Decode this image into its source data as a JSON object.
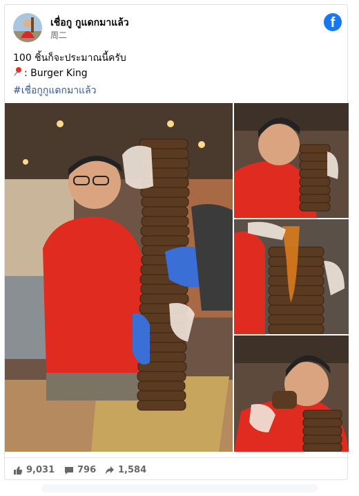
{
  "post": {
    "author": "เชื่อกู กูแดกมาแล้ว",
    "time": "周二",
    "brand_icon": "facebook-icon",
    "text_line1": "100 ชิ้นก็จะประมาณนี้ครับ",
    "text_line2": ": Burger King",
    "pin_icon": "round-pushpin-icon",
    "hashtag": "#เชื่อกูกูแดกมาแล้ว"
  },
  "stats": {
    "likes": "9,031",
    "comments": "796",
    "shares": "1,584"
  },
  "colors": {
    "brand": "#1877f2",
    "hashtag": "#385898",
    "muted": "#65676b",
    "shirt": "#e02b20"
  }
}
